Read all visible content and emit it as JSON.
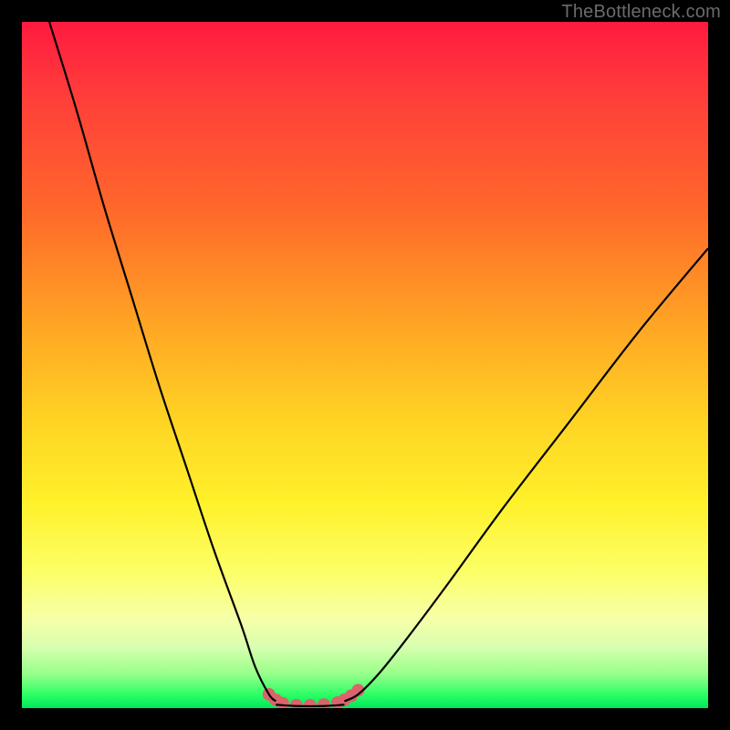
{
  "watermark": "TheBottleneck.com",
  "chart_data": {
    "type": "line",
    "title": "",
    "xlabel": "",
    "ylabel": "",
    "xlim": [
      0,
      100
    ],
    "ylim": [
      0,
      100
    ],
    "series": [
      {
        "name": "bottleneck-curve-left",
        "x": [
          4,
          8,
          12,
          16,
          20,
          24,
          28,
          32,
          34,
          36,
          37
        ],
        "y": [
          100,
          87,
          73,
          60,
          47,
          35,
          23,
          12,
          6,
          2,
          1
        ]
      },
      {
        "name": "bottleneck-curve-right",
        "x": [
          47,
          49,
          52,
          56,
          62,
          70,
          80,
          90,
          100
        ],
        "y": [
          1,
          2,
          5,
          10,
          18,
          29,
          42,
          55,
          67
        ]
      },
      {
        "name": "bottleneck-flat-bottom",
        "x": [
          37,
          40,
          44,
          47
        ],
        "y": [
          0.5,
          0.3,
          0.3,
          0.5
        ]
      }
    ],
    "markers": {
      "name": "optimal-zone-dots",
      "x": [
        36,
        37,
        38,
        40,
        42,
        44,
        46,
        47,
        48,
        49
      ],
      "y": [
        2.0,
        1.2,
        0.7,
        0.4,
        0.4,
        0.5,
        0.8,
        1.2,
        1.8,
        2.6
      ],
      "color": "#d9646b",
      "radius": 7
    },
    "curve_color": "#000000",
    "grid": false,
    "legend": false
  }
}
